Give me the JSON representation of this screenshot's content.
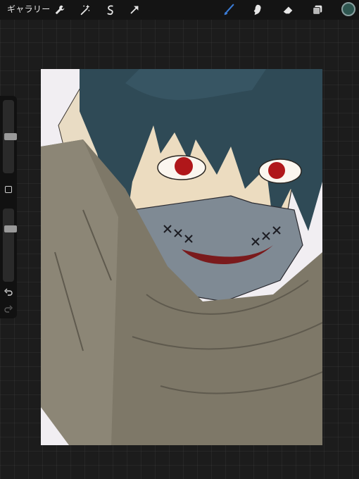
{
  "toolbar": {
    "gallery_label": "ギャラリー",
    "left_tools": [
      "wrench-icon",
      "magic-wand-icon",
      "selection-icon",
      "move-arrow-icon"
    ],
    "right_tools": [
      "brush-icon",
      "smudge-icon",
      "eraser-icon",
      "layers-icon"
    ],
    "active_tool": "brush-icon",
    "accent_color": "#3a7bd5",
    "current_color": "#2e5650"
  },
  "sidebar": {
    "size_slider_level": 0.5,
    "opacity_slider_level": 0.75,
    "buttons": [
      "modify-square-icon",
      "undo-icon",
      "redo-icon"
    ]
  },
  "canvas": {
    "subject": "artwork",
    "palette": {
      "hair": "#2f4a56",
      "skin": "#ecdcc0",
      "mask": "#7f8a94",
      "cloth": "#7e7868",
      "eyes": "#b0171a",
      "background": "#f1eef2"
    }
  }
}
